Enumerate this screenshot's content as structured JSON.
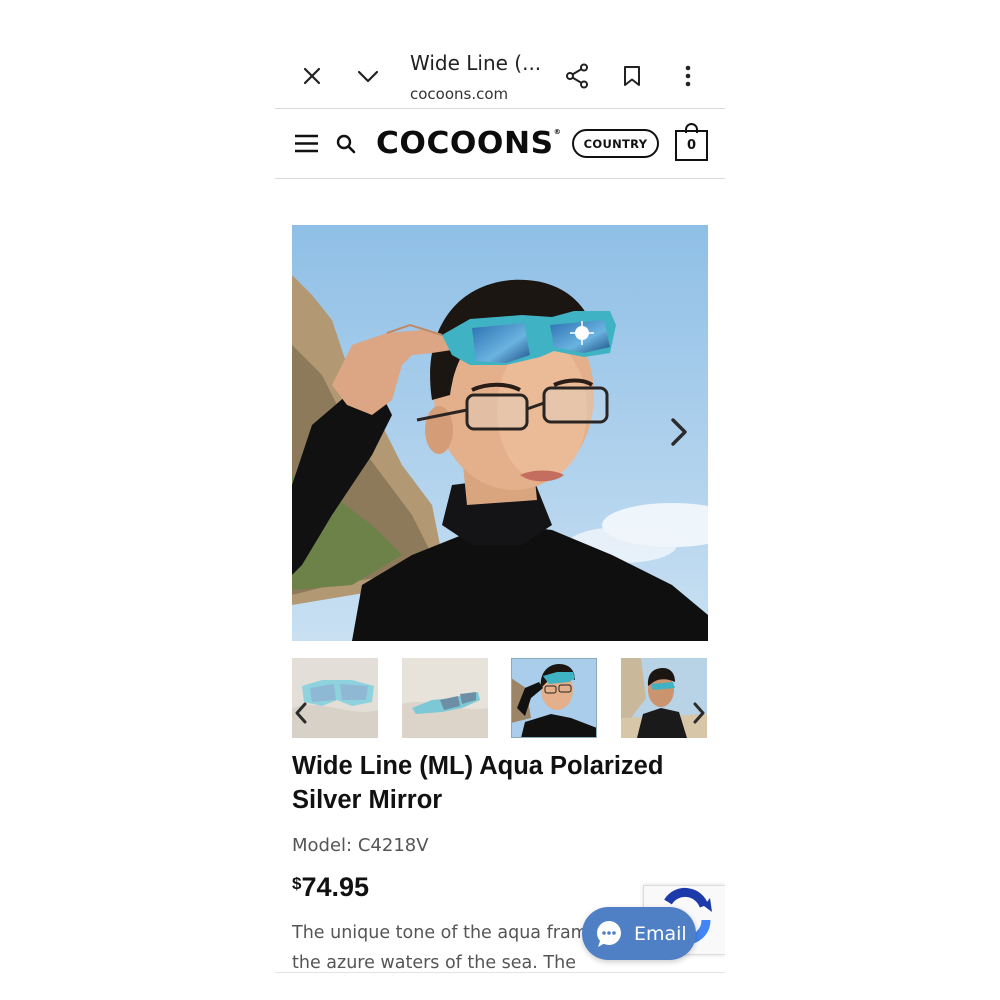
{
  "browser": {
    "title": "Wide Line (...",
    "host": "cocoons.com"
  },
  "header": {
    "brand": "COCOONS",
    "brand_mark": "®",
    "country_label": "COUNTRY",
    "cart_count": "0"
  },
  "gallery": {
    "thumbnail_count": 4,
    "selected_thumbnail": 3
  },
  "product": {
    "title": "Wide Line (ML) Aqua Polarized Silver Mirror",
    "model_label": "Model:",
    "model_value": "C4218V",
    "currency": "$",
    "price": "74.95",
    "description": "The unique tone of the aqua frame is the azure waters of the sea. The crystal"
  },
  "chat": {
    "email_label": "Email"
  },
  "colors": {
    "accent": "#4f7fc4",
    "frame_aqua": "#3fb3c4",
    "sky": "#a9cdea"
  }
}
